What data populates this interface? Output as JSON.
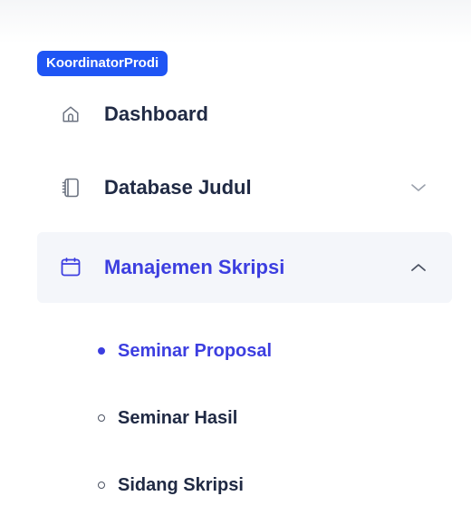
{
  "role_badge": {
    "label": "KoordinatorProdi",
    "color": "#1f55f4"
  },
  "sidebar": {
    "items": [
      {
        "label": "Dashboard",
        "icon": "home-icon",
        "expandable": false,
        "active": false
      },
      {
        "label": "Database Judul",
        "icon": "notebook-icon",
        "expandable": true,
        "expanded": false,
        "chevron": "chevron-down-icon",
        "active": false
      },
      {
        "label": "Manajemen Skripsi",
        "icon": "calendar-icon",
        "expandable": true,
        "expanded": true,
        "chevron": "chevron-up-icon",
        "active": true,
        "children": [
          {
            "label": "Seminar Proposal",
            "current": true
          },
          {
            "label": "Seminar Hasil",
            "current": false
          },
          {
            "label": "Sidang Skripsi",
            "current": false
          }
        ]
      }
    ]
  },
  "colors": {
    "text_primary": "#202a44",
    "accent": "#3c3ee0",
    "active_background": "#f4f6fa",
    "icon_gray": "#6b7280"
  }
}
